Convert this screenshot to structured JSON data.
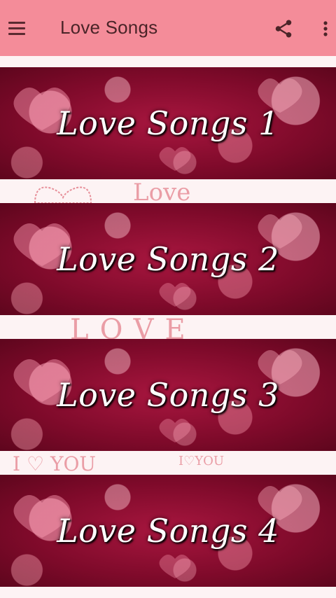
{
  "app_bar": {
    "title": "Love Songs",
    "menu_icon": "hamburger-menu-icon",
    "share_icon": "share-icon",
    "more_icon": "more-vert-icon"
  },
  "colors": {
    "app_bar": "#f48c99",
    "banner_base": "#8e0e33",
    "doodle": "#e78f99"
  },
  "banners": [
    {
      "label": "Love Songs 1"
    },
    {
      "label": "Love Songs 2"
    },
    {
      "label": "Love Songs 3"
    },
    {
      "label": "Love Songs 4"
    }
  ],
  "doodles": [
    {
      "text": "Love"
    },
    {
      "text": "LOVE"
    },
    {
      "text": "I ♡ YOU"
    },
    {
      "text": "I♡YOU"
    }
  ]
}
